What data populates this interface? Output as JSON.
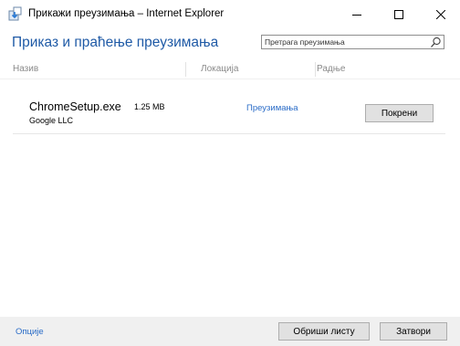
{
  "window": {
    "title": "Прикажи преузимања – Internet Explorer"
  },
  "header": {
    "title": "Приказ и праћење преузимања",
    "search_placeholder": "Претрага преузимања"
  },
  "columns": {
    "name": "Назив",
    "location": "Локација",
    "actions": "Радње"
  },
  "downloads": [
    {
      "file_name": "ChromeSetup.exe",
      "size": "1.25 MB",
      "publisher": "Google LLC",
      "location_link": "Преузимања",
      "action_label": "Покрени"
    }
  ],
  "footer": {
    "options_label": "Опције",
    "clear_list_label": "Обриши листу",
    "close_label": "Затвори"
  },
  "colors": {
    "accent_title": "#1f5aa6",
    "link": "#2a6cc7",
    "footer_bg": "#f0f0f0",
    "button_bg": "#e1e1e1"
  },
  "icons": {
    "app": "ie-download-icon",
    "search": "search-icon",
    "minimize": "minimize-icon",
    "maximize": "maximize-icon",
    "close": "close-icon"
  }
}
